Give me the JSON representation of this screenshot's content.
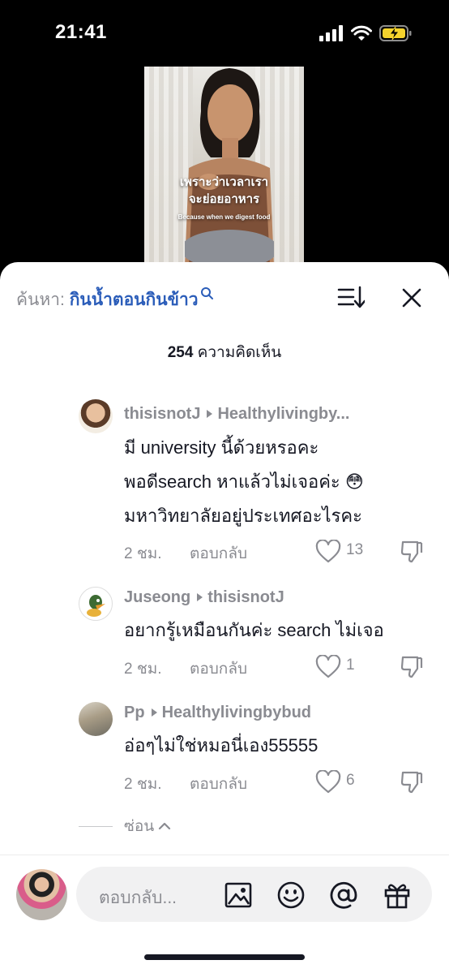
{
  "status": {
    "time": "21:41"
  },
  "video": {
    "caption_th_line1": "เพราะว่าเวลาเรา",
    "caption_th_line2": "จะย่อยอาหาร",
    "caption_en": "Because when we digest food"
  },
  "search": {
    "prefix": "ค้นหา: ",
    "query": "กินน้ำตอนกินข้าว"
  },
  "comments_header": {
    "count": "254",
    "label": " ความคิดเห็น"
  },
  "comments": [
    {
      "author": "thisisnotJ",
      "reply_to": "Healthylivingby...",
      "lines": [
        "มี university นี้ด้วยหรอคะ",
        "พอดีsearch หาแล้วไม่เจอค่ะ 😳",
        "มหาวิทยาลัยอยู่ประเทศอะไรคะ"
      ],
      "time": "2 ชม.",
      "reply_label": "ตอบกลับ",
      "likes": "13"
    },
    {
      "author": "Juseong",
      "reply_to": "thisisnotJ",
      "lines": [
        "อยากรู้เหมือนกันค่ะ search ไม่เจอ"
      ],
      "time": "2 ชม.",
      "reply_label": "ตอบกลับ",
      "likes": "1"
    },
    {
      "author": "Pp",
      "reply_to": "Healthylivingbybud",
      "lines": [
        "อ่อๆไม่ใช่หมอนี่เอง55555"
      ],
      "time": "2 ชม.",
      "reply_label": "ตอบกลับ",
      "likes": "6"
    }
  ],
  "hide_label": "ซ่อน",
  "reply_box": {
    "placeholder": "ตอบกลับ..."
  },
  "icons": [
    "signal-icon",
    "wifi-icon",
    "battery-charging-icon",
    "search-icon",
    "sort-icon",
    "close-icon",
    "heart-icon",
    "dislike-icon",
    "chevron-up-icon",
    "image-icon",
    "emoji-icon",
    "mention-icon",
    "gift-icon"
  ],
  "colors": {
    "query": "#2b5db9",
    "muted": "#8a8b91",
    "battery": "#f5d32d"
  }
}
